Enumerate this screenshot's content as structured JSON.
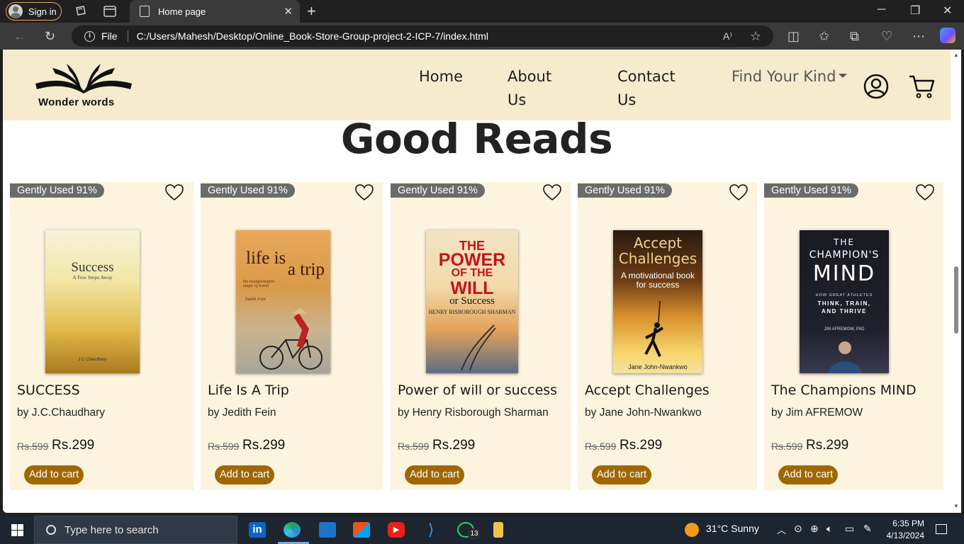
{
  "browser": {
    "signin_label": "Sign in",
    "tab_title": "Home page",
    "address_prefix": "File",
    "address_url": "C:/Users/Mahesh/Desktop/Online_Book-Store-Group-project-2-ICP-7/index.html"
  },
  "site": {
    "logo_text": "Wonder words",
    "nav": {
      "home": "Home",
      "about_line1": "About",
      "about_line2": "Us",
      "contact_line1": "Contact",
      "contact_line2": "Us",
      "find_kind": "Find Your Kind"
    },
    "section_title": "Good Reads",
    "books": [
      {
        "badge": "Gently Used 91%",
        "title": "SUCCESS",
        "author": "by J.C.Chaudhary",
        "old_price": "Rs.599",
        "price": "Rs.299",
        "button": "Add to cart",
        "cover": {
          "line1": "Success",
          "line2": "A Few Steps Away",
          "footer": "J C Chaudhary"
        }
      },
      {
        "badge": "Gently Used 91%",
        "title": "Life Is A Trip",
        "author": "by Jedith Fein",
        "old_price": "Rs.599",
        "price": "Rs.299",
        "button": "Add to cart",
        "cover": {
          "line1": "life is",
          "line2": "a trip",
          "line3": "the transformative magic of travel",
          "footer": "Judith Fein"
        }
      },
      {
        "badge": "Gently Used 91%",
        "title": "Power of will or success",
        "author": "by Henry Risborough Sharman",
        "old_price": "Rs.599",
        "price": "Rs.299",
        "button": "Add to cart",
        "cover": {
          "line1": "THE",
          "line2": "POWER",
          "line3": "OF THE",
          "line4": "WILL",
          "line5": "or Success",
          "footer": "HENRY RISBOROUGH SHARMAN"
        }
      },
      {
        "badge": "Gently Used 91%",
        "title": "Accept Challenges",
        "author": "by Jane John-Nwankwo",
        "old_price": "Rs.599",
        "price": "Rs.299",
        "button": "Add to cart",
        "cover": {
          "line1": "Accept",
          "line2": "Challenges",
          "line3": "A motivational book for success",
          "footer": "Jane John-Nwankwo"
        }
      },
      {
        "badge": "Gently Used 91%",
        "title": "The Champions MIND",
        "author": "by Jim AFREMOW",
        "old_price": "Rs.599",
        "price": "Rs.299",
        "button": "Add to cart",
        "cover": {
          "line1": "THE",
          "line2": "CHAMPION'S",
          "line3": "MIND",
          "line4": "HOW GREAT ATHLETES",
          "line5": "THINK, TRAIN, AND THRIVE",
          "footer": "JIM AFREMOW, PhD"
        }
      }
    ]
  },
  "taskbar": {
    "search_placeholder": "Type here to search",
    "whatsapp_count": "13",
    "weather": "31°C  Sunny",
    "time": "6:35 PM",
    "date": "4/13/2024"
  }
}
